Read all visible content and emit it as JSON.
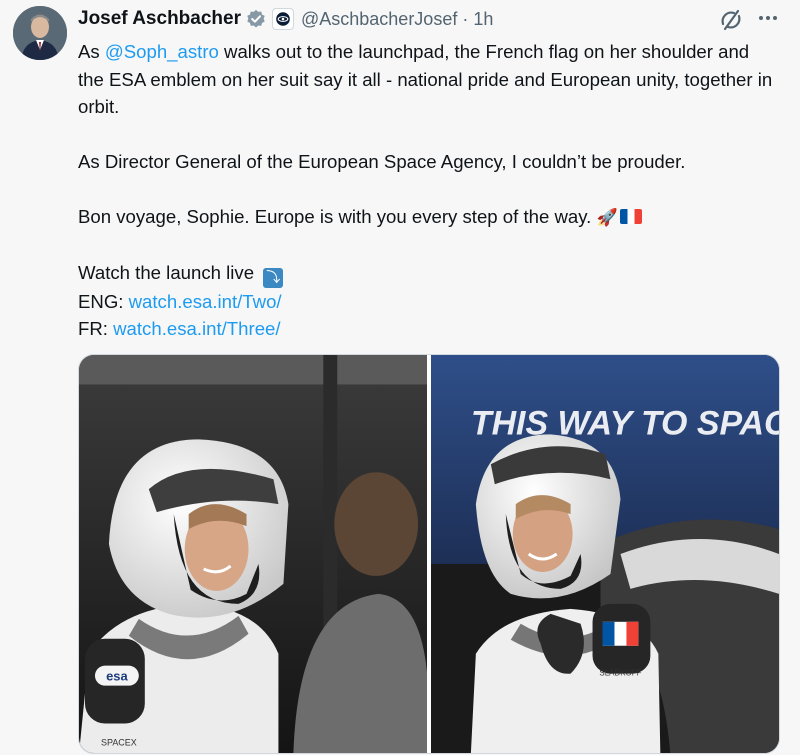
{
  "author": {
    "name": "Josef Aschbacher",
    "handle": "@AschbacherJosef",
    "separator": "·",
    "time": "1h"
  },
  "icons": {
    "verified": "verified-check-icon",
    "org_badge": "esa-affiliate-badge-icon",
    "grok": "grok-icon",
    "more": "more-horizontal-icon",
    "rocket": "rocket-emoji",
    "flag_fr": "french-flag-emoji",
    "arrow": "down-arrow-emoji"
  },
  "colors": {
    "link": "#1d9bf0",
    "verified": "#8899a6"
  },
  "tweet": {
    "p1_before": "As ",
    "p1_mention": "@Soph_astro",
    "p1_after": " walks out to the launchpad, the French flag on her shoulder and the ESA emblem on her suit say it all - national pride and European unity, together in orbit.",
    "p2": "As Director General of the European Space Agency, I couldn’t be prouder.",
    "p3": "Bon voyage, Sophie. Europe is with you every step of the way.",
    "p3_rocket": "🚀",
    "watch": "Watch the launch live",
    "arrow_glyph": "⤵",
    "eng_label": "ENG: ",
    "eng_link": "watch.esa.int/Two/",
    "fr_label": "FR: ",
    "fr_link": "watch.esa.int/Three/"
  },
  "media": {
    "photo1": {
      "suit_patch": "esa",
      "suit_name": "SPACEX"
    },
    "photo2": {
      "banner": "THIS WAY TO SPACE",
      "suit_name": "SLADKOFF"
    }
  }
}
